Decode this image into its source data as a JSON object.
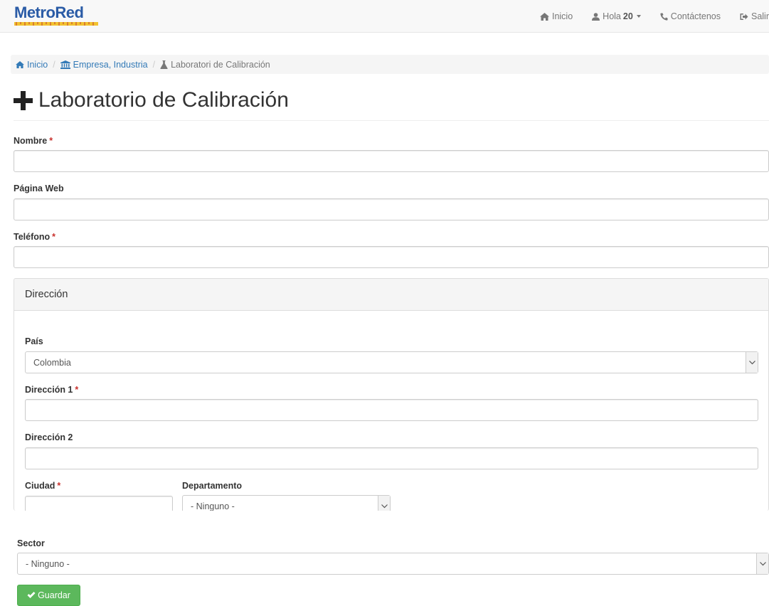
{
  "navbar": {
    "brand": "MetroRed",
    "items": [
      {
        "label": "Inicio",
        "icon": "home-icon"
      },
      {
        "label": "Hola",
        "bold": "20",
        "icon": "user-icon"
      },
      {
        "label": "Contáctenos",
        "icon": "phone-icon"
      },
      {
        "label": "Salir",
        "icon": "logout-icon"
      }
    ]
  },
  "breadcrumb": {
    "items": [
      {
        "label": "Inicio",
        "icon": "home-icon"
      },
      {
        "label": "Empresa, Industria",
        "icon": "bank-icon"
      }
    ],
    "active": {
      "label": "Laboratori de Calibración",
      "icon": "flask-icon"
    }
  },
  "page": {
    "title": "Laboratorio de Calibración",
    "title_icon": "plus-icon"
  },
  "form": {
    "nombre": {
      "label": "Nombre",
      "required": "*",
      "value": ""
    },
    "web": {
      "label": "Página Web",
      "value": ""
    },
    "telefono": {
      "label": "Teléfono",
      "required": "*",
      "value": ""
    },
    "direccion_panel": {
      "heading": "Dirección",
      "pais": {
        "label": "País",
        "value": "Colombia"
      },
      "direccion1": {
        "label": "Dirección 1",
        "required": "*",
        "value": ""
      },
      "direccion2": {
        "label": "Dirección 2",
        "value": ""
      },
      "ciudad": {
        "label": "Ciudad",
        "required": "*",
        "value": ""
      },
      "departamento": {
        "label": "Departamento",
        "value": "- Ninguno -"
      }
    },
    "sector": {
      "label": "Sector",
      "value": "- Ninguno -"
    },
    "save_label": "Guardar"
  },
  "colors": {
    "brand": "#2a5ba6",
    "link": "#337ab7",
    "success": "#5cb85c",
    "required": "#c9302c"
  }
}
